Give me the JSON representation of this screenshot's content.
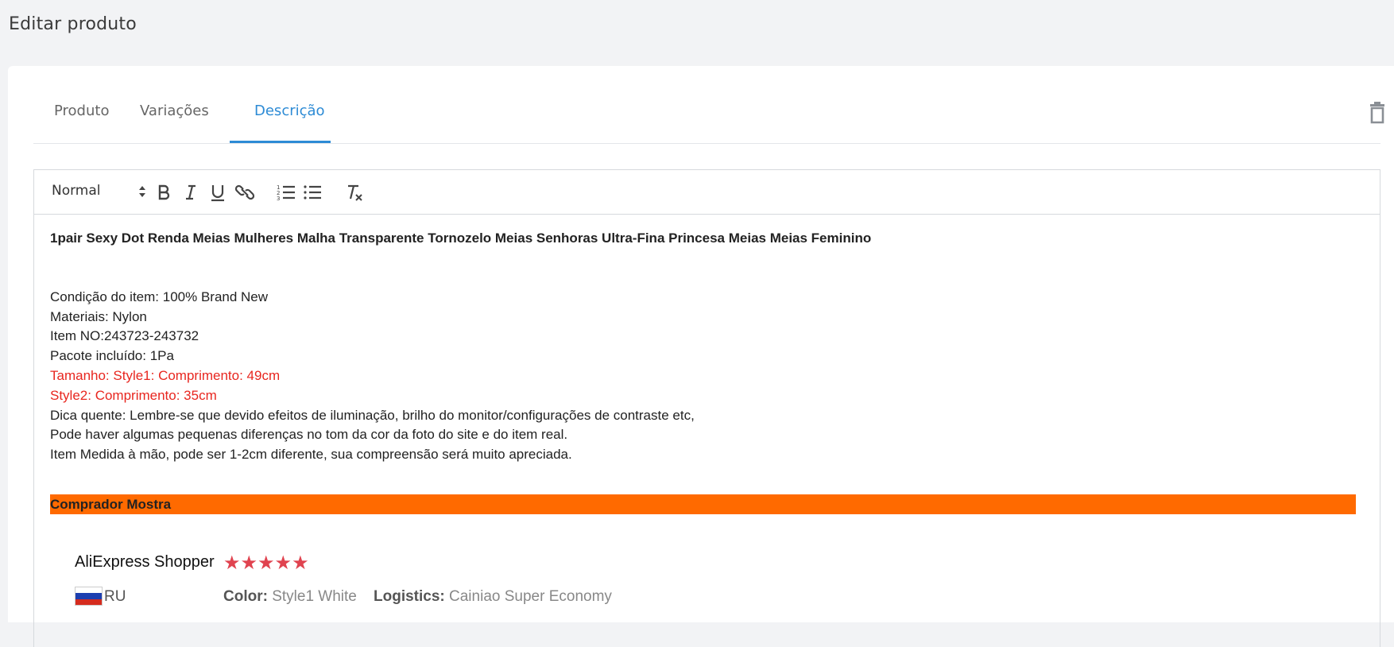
{
  "page_title": "Editar produto",
  "tabs": [
    {
      "label": "Produto"
    },
    {
      "label": "Variações"
    },
    {
      "label": "Descrição"
    }
  ],
  "icons": {
    "trash": "trash-icon",
    "bold": "bold-icon",
    "italic": "italic-icon",
    "underline": "underline-icon",
    "link": "link-icon",
    "ordered_list": "ordered-list-icon",
    "bullet_list": "bullet-list-icon",
    "clear_format": "clear-format-icon"
  },
  "colors": {
    "accent": "#2d8bd5",
    "highlight": "#ff6a00",
    "red_text": "#e8261f",
    "stars": "#e0434f"
  },
  "toolbar": {
    "format_select": "Normal"
  },
  "description": {
    "headline": "1pair Sexy Dot Renda Meias Mulheres Malha Transparente Tornozelo Meias Senhoras Ultra-Fina Princesa Meias Meias Feminino",
    "lines": [
      "Condição do item: 100% Brand New",
      "Materiais: Nylon",
      "Item NO:243723-243732",
      "Pacote incluído: 1Pa"
    ],
    "red_lines": [
      "Tamanho: Style1: Comprimento: 49cm",
      "Style2: Comprimento: 35cm"
    ],
    "tip_lines": [
      "Dica quente: Lembre-se que devido efeitos de iluminação, brilho do monitor/configurações de contraste etc,",
      "Pode haver algumas pequenas diferenças no tom da cor da foto do site e do item real.",
      "Item Medida à mão, pode ser 1-2cm diferente, sua compreensão será muito apreciada."
    ],
    "section_heading": "Comprador Mostra"
  },
  "review": {
    "shopper": "AliExpress Shopper",
    "rating": 5,
    "stars": "★★★★★",
    "country": "RU",
    "color_label": "Color:",
    "color_value": "Style1 White",
    "logistics_label": "Logistics:",
    "logistics_value": "Cainiao Super Economy"
  }
}
